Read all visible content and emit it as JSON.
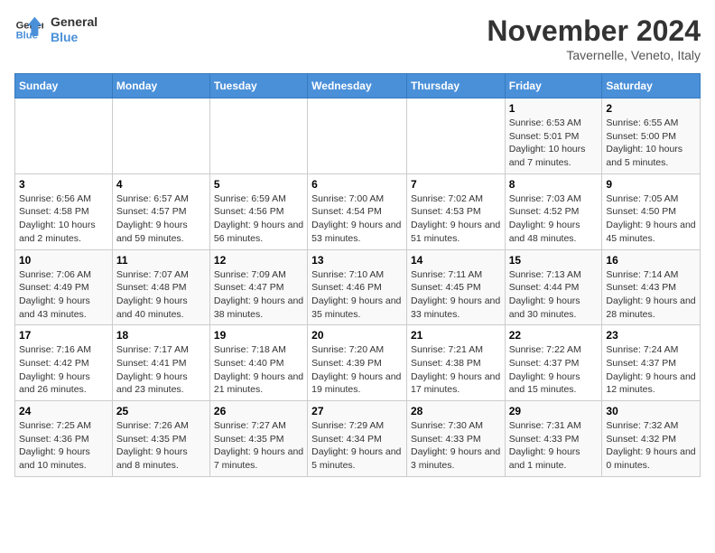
{
  "logo": {
    "line1": "General",
    "line2": "Blue"
  },
  "title": "November 2024",
  "subtitle": "Tavernelle, Veneto, Italy",
  "days_of_week": [
    "Sunday",
    "Monday",
    "Tuesday",
    "Wednesday",
    "Thursday",
    "Friday",
    "Saturday"
  ],
  "weeks": [
    [
      {
        "day": "",
        "info": ""
      },
      {
        "day": "",
        "info": ""
      },
      {
        "day": "",
        "info": ""
      },
      {
        "day": "",
        "info": ""
      },
      {
        "day": "",
        "info": ""
      },
      {
        "day": "1",
        "info": "Sunrise: 6:53 AM\nSunset: 5:01 PM\nDaylight: 10 hours and 7 minutes."
      },
      {
        "day": "2",
        "info": "Sunrise: 6:55 AM\nSunset: 5:00 PM\nDaylight: 10 hours and 5 minutes."
      }
    ],
    [
      {
        "day": "3",
        "info": "Sunrise: 6:56 AM\nSunset: 4:58 PM\nDaylight: 10 hours and 2 minutes."
      },
      {
        "day": "4",
        "info": "Sunrise: 6:57 AM\nSunset: 4:57 PM\nDaylight: 9 hours and 59 minutes."
      },
      {
        "day": "5",
        "info": "Sunrise: 6:59 AM\nSunset: 4:56 PM\nDaylight: 9 hours and 56 minutes."
      },
      {
        "day": "6",
        "info": "Sunrise: 7:00 AM\nSunset: 4:54 PM\nDaylight: 9 hours and 53 minutes."
      },
      {
        "day": "7",
        "info": "Sunrise: 7:02 AM\nSunset: 4:53 PM\nDaylight: 9 hours and 51 minutes."
      },
      {
        "day": "8",
        "info": "Sunrise: 7:03 AM\nSunset: 4:52 PM\nDaylight: 9 hours and 48 minutes."
      },
      {
        "day": "9",
        "info": "Sunrise: 7:05 AM\nSunset: 4:50 PM\nDaylight: 9 hours and 45 minutes."
      }
    ],
    [
      {
        "day": "10",
        "info": "Sunrise: 7:06 AM\nSunset: 4:49 PM\nDaylight: 9 hours and 43 minutes."
      },
      {
        "day": "11",
        "info": "Sunrise: 7:07 AM\nSunset: 4:48 PM\nDaylight: 9 hours and 40 minutes."
      },
      {
        "day": "12",
        "info": "Sunrise: 7:09 AM\nSunset: 4:47 PM\nDaylight: 9 hours and 38 minutes."
      },
      {
        "day": "13",
        "info": "Sunrise: 7:10 AM\nSunset: 4:46 PM\nDaylight: 9 hours and 35 minutes."
      },
      {
        "day": "14",
        "info": "Sunrise: 7:11 AM\nSunset: 4:45 PM\nDaylight: 9 hours and 33 minutes."
      },
      {
        "day": "15",
        "info": "Sunrise: 7:13 AM\nSunset: 4:44 PM\nDaylight: 9 hours and 30 minutes."
      },
      {
        "day": "16",
        "info": "Sunrise: 7:14 AM\nSunset: 4:43 PM\nDaylight: 9 hours and 28 minutes."
      }
    ],
    [
      {
        "day": "17",
        "info": "Sunrise: 7:16 AM\nSunset: 4:42 PM\nDaylight: 9 hours and 26 minutes."
      },
      {
        "day": "18",
        "info": "Sunrise: 7:17 AM\nSunset: 4:41 PM\nDaylight: 9 hours and 23 minutes."
      },
      {
        "day": "19",
        "info": "Sunrise: 7:18 AM\nSunset: 4:40 PM\nDaylight: 9 hours and 21 minutes."
      },
      {
        "day": "20",
        "info": "Sunrise: 7:20 AM\nSunset: 4:39 PM\nDaylight: 9 hours and 19 minutes."
      },
      {
        "day": "21",
        "info": "Sunrise: 7:21 AM\nSunset: 4:38 PM\nDaylight: 9 hours and 17 minutes."
      },
      {
        "day": "22",
        "info": "Sunrise: 7:22 AM\nSunset: 4:37 PM\nDaylight: 9 hours and 15 minutes."
      },
      {
        "day": "23",
        "info": "Sunrise: 7:24 AM\nSunset: 4:37 PM\nDaylight: 9 hours and 12 minutes."
      }
    ],
    [
      {
        "day": "24",
        "info": "Sunrise: 7:25 AM\nSunset: 4:36 PM\nDaylight: 9 hours and 10 minutes."
      },
      {
        "day": "25",
        "info": "Sunrise: 7:26 AM\nSunset: 4:35 PM\nDaylight: 9 hours and 8 minutes."
      },
      {
        "day": "26",
        "info": "Sunrise: 7:27 AM\nSunset: 4:35 PM\nDaylight: 9 hours and 7 minutes."
      },
      {
        "day": "27",
        "info": "Sunrise: 7:29 AM\nSunset: 4:34 PM\nDaylight: 9 hours and 5 minutes."
      },
      {
        "day": "28",
        "info": "Sunrise: 7:30 AM\nSunset: 4:33 PM\nDaylight: 9 hours and 3 minutes."
      },
      {
        "day": "29",
        "info": "Sunrise: 7:31 AM\nSunset: 4:33 PM\nDaylight: 9 hours and 1 minute."
      },
      {
        "day": "30",
        "info": "Sunrise: 7:32 AM\nSunset: 4:32 PM\nDaylight: 9 hours and 0 minutes."
      }
    ]
  ]
}
